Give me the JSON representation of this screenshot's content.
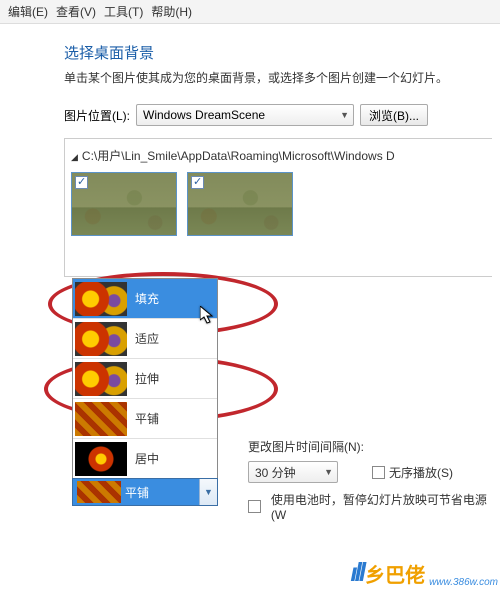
{
  "menubar": {
    "items": [
      "编辑(E)",
      "查看(V)",
      "工具(T)",
      "帮助(H)"
    ]
  },
  "title": "选择桌面背景",
  "subtitle": "单击某个图片使其成为您的桌面背景，或选择多个图片创建一个幻灯片。",
  "location": {
    "label": "图片位置(L):",
    "value": "Windows DreamScene",
    "browse": "浏览(B)..."
  },
  "path": "C:\\用户\\Lin_Smile\\AppData\\Roaming\\Microsoft\\Windows D",
  "fit": {
    "options": [
      "填充",
      "适应",
      "拉伸",
      "平铺",
      "居中"
    ],
    "combo_value": "平铺"
  },
  "interval": {
    "label": "更改图片时间间隔(N):",
    "value": "30 分钟"
  },
  "shuffle": {
    "label": "无序播放(S)"
  },
  "battery": {
    "label": "使用电池时，暂停幻灯片放映可节省电源(W"
  },
  "watermark": {
    "brand": "乡巴佬",
    "url": "www.386w.com"
  }
}
